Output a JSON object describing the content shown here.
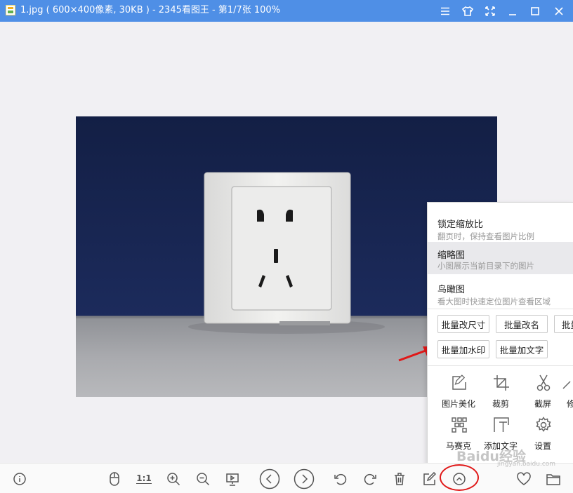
{
  "window": {
    "title": "1.jpg ( 600×400像素, 30KB ) - 2345看图王 - 第1/7张 100%",
    "controls": [
      "menu-icon",
      "skin-icon",
      "fullscreen-icon",
      "minimize-icon",
      "maximize-icon",
      "close-icon"
    ]
  },
  "image": {
    "description_icon": "socket-photo",
    "colors": {
      "wall": "#15224a",
      "table": "#a8a9ad",
      "socket": "#e8e8e6"
    }
  },
  "panel": {
    "items": [
      {
        "title": "锁定缩放比",
        "desc": "翻页时，保持查看图片比例"
      },
      {
        "title": "缩略图",
        "desc": "小图展示当前目录下的图片"
      },
      {
        "title": "鸟瞰图",
        "desc": "看大图时快速定位图片查看区域"
      }
    ],
    "batch_buttons": [
      "批量改尺寸",
      "批量改名",
      "批量",
      "批量加水印",
      "批量加文字"
    ],
    "tools": [
      {
        "icon": "edit-icon",
        "label": "图片美化"
      },
      {
        "icon": "crop-icon",
        "label": "裁剪"
      },
      {
        "icon": "scissors-icon",
        "label": "截屏"
      },
      {
        "icon": "partial-icon",
        "label": "修"
      },
      {
        "icon": "mosaic-icon",
        "label": "马赛克"
      },
      {
        "icon": "add-text-icon",
        "label": "添加文字"
      },
      {
        "icon": "gear-icon",
        "label": "设置"
      }
    ]
  },
  "toolbar": {
    "one_to_one": "1:1",
    "buttons": [
      "info-icon",
      "mouse-icon",
      "zoom-in-icon",
      "zoom-out-icon",
      "slideshow-icon",
      "prev-icon",
      "next-icon",
      "rotate-left-icon",
      "rotate-right-icon",
      "delete-icon",
      "edit-icon",
      "more-icon",
      "favorite-icon",
      "folder-icon"
    ]
  },
  "watermark": {
    "text": "Baidu经验",
    "sub": "jingyan.baidu.com"
  },
  "accent": {
    "title_bar": "#4f8fe6",
    "annotation": "#e01818"
  }
}
